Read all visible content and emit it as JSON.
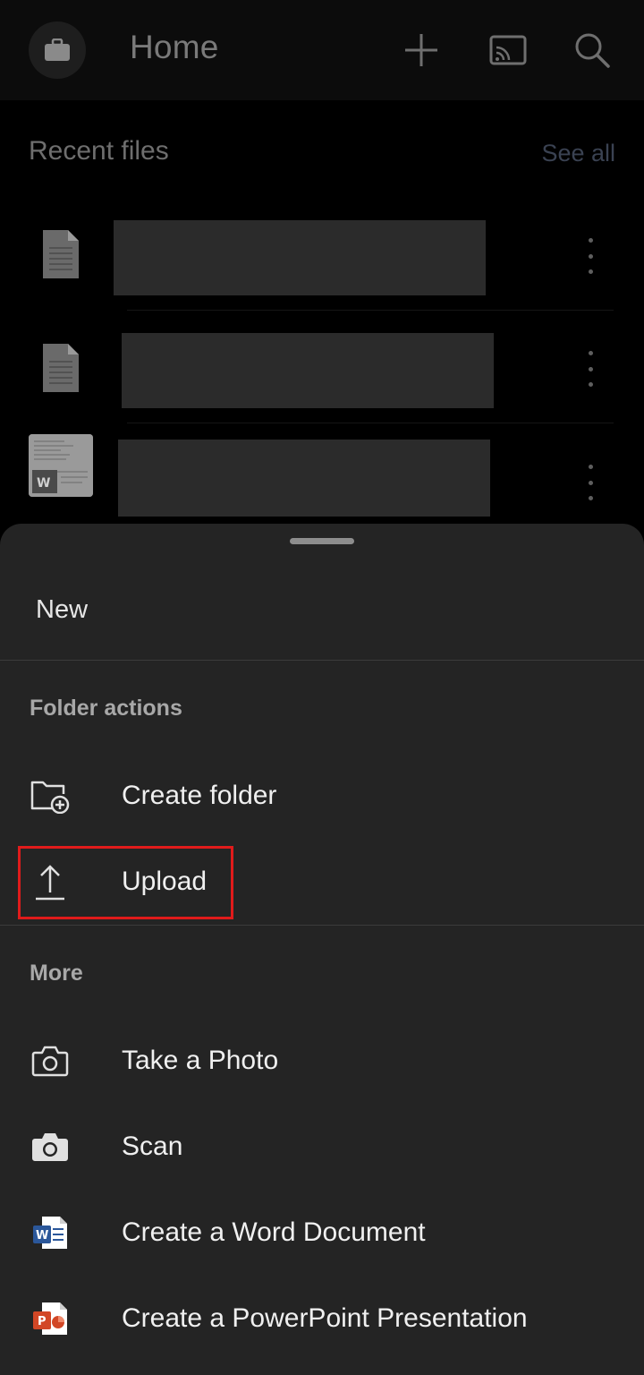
{
  "appbar": {
    "title": "Home",
    "icons": [
      "briefcase-icon",
      "plus-icon",
      "cast-icon",
      "search-icon"
    ]
  },
  "recent": {
    "title": "Recent files",
    "see_all": "See all",
    "files": [
      {
        "icon": "document-icon",
        "name": ""
      },
      {
        "icon": "document-icon",
        "name": ""
      },
      {
        "icon": "word-thumbnail",
        "name": ""
      }
    ]
  },
  "sheet": {
    "title": "New",
    "folder_actions": {
      "heading": "Folder actions",
      "items": [
        {
          "label": "Create folder",
          "icon": "folder-add-icon"
        },
        {
          "label": "Upload",
          "icon": "upload-icon"
        }
      ]
    },
    "more": {
      "heading": "More",
      "items": [
        {
          "label": "Take a Photo",
          "icon": "camera-outline-icon"
        },
        {
          "label": "Scan",
          "icon": "camera-filled-icon"
        },
        {
          "label": "Create a Word Document",
          "icon": "word-icon"
        },
        {
          "label": "Create a PowerPoint Presentation",
          "icon": "powerpoint-icon"
        }
      ]
    }
  },
  "colors": {
    "highlight": "#e01b1b",
    "sheet_bg": "#242424",
    "word_blue": "#2b579a",
    "powerpoint_red": "#d24726"
  }
}
